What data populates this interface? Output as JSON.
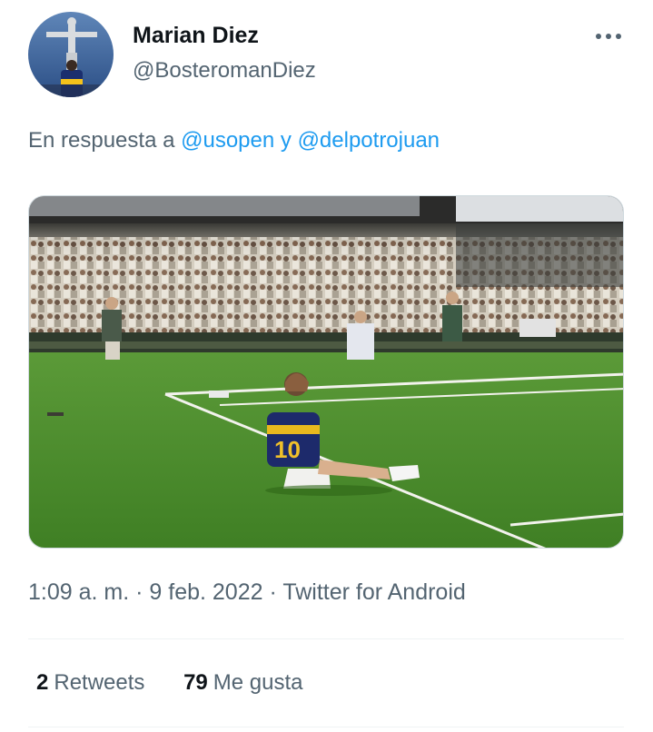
{
  "tweet": {
    "author": {
      "display_name": "Marian Diez",
      "handle": "@BosteromanDiez",
      "avatar_icon": "avatar-christ-redeemer"
    },
    "more_icon": "more-horizontal-icon",
    "reply": {
      "prefix": "En respuesta a",
      "mention_1": "@usopen",
      "joiner": "y",
      "mention_2": "@delpotrojuan"
    },
    "media": {
      "jersey_number": "10"
    },
    "meta": {
      "time": "1:09 a. m.",
      "sep_1": "·",
      "date": "9 feb. 2022",
      "sep_2": "·",
      "source": "Twitter for Android"
    },
    "stats": {
      "retweets_count": "2",
      "retweets_label": "Retweets",
      "likes_count": "79",
      "likes_label": "Me gusta"
    }
  },
  "colors": {
    "accent": "#1d9bf0",
    "secondary_text": "#536471",
    "primary_text": "#0f1419",
    "divider": "#eff3f4"
  }
}
